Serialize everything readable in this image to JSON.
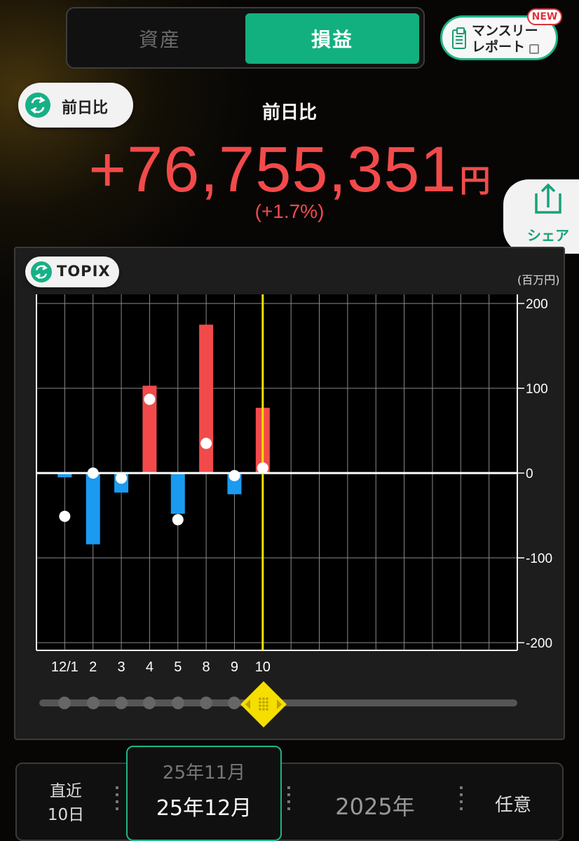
{
  "tabs": {
    "assets": "資産",
    "pnl": "損益"
  },
  "report": {
    "line1": "マンスリー",
    "line2": "レポート",
    "badge": "NEW"
  },
  "comparison": {
    "button_label": "前日比",
    "title": "前日比",
    "value": "+76,755,351",
    "unit": "円",
    "percent": "(+1.7%)"
  },
  "share": {
    "label": "シェア"
  },
  "benchmark": {
    "label": "TOPIX"
  },
  "colors": {
    "accent": "#12b07e",
    "gain": "#f24a4a",
    "loss": "#1a9bf0",
    "marker": "#f5e000"
  },
  "chart_data": {
    "type": "bar",
    "unit_label": "(百万円)",
    "categories": [
      "12/1",
      "2",
      "3",
      "4",
      "5",
      "8",
      "9",
      "10"
    ],
    "series": [
      {
        "values": [
          -5,
          -84,
          -23,
          103,
          -48,
          175,
          -25,
          77
        ]
      },
      {
        "values": [
          -51,
          0,
          -6,
          87,
          -55,
          35,
          -3,
          6
        ]
      }
    ],
    "ylim": [
      -200,
      200
    ],
    "yticks": [
      200,
      100,
      0,
      -100,
      -200
    ],
    "ytick_labels": [
      "200",
      "100",
      "0",
      "-100",
      "-200"
    ],
    "slots": 17,
    "selected_index": 7,
    "grid": true
  },
  "periods": {
    "recent": {
      "line1": "直近",
      "line2": "10日"
    },
    "prev_month": "25年11月",
    "current_month": "25年12月",
    "year": "2025年",
    "custom": "任意"
  }
}
